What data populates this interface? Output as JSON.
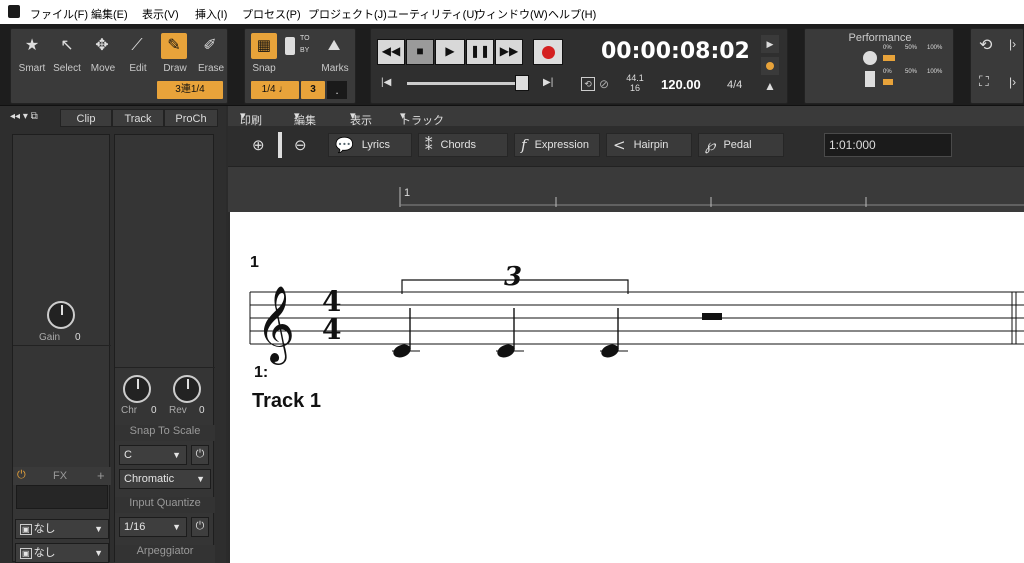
{
  "menubar": {
    "items": [
      "ファイル(F)",
      "編集(E)",
      "表示(V)",
      "挿入(I)",
      "プロセス(P)",
      "プロジェクト(J)",
      "ユーティリティ(U)",
      "ウィンドウ(W)",
      "ヘルプ(H)"
    ]
  },
  "tools": {
    "items": [
      "Smart",
      "Select",
      "Move",
      "Edit",
      "Draw",
      "Erase"
    ],
    "active": "Draw",
    "triplet_value": "3連1/4"
  },
  "snap": {
    "label": "Snap",
    "marks_label": "Marks",
    "value": "1/4",
    "note_glyph": "♩",
    "tuplet": "3",
    "dot": ".",
    "to_by": [
      "TO",
      "BY"
    ]
  },
  "transport": {
    "time": "00:00:08:02",
    "sample_rate": "44.1",
    "bit_depth": "16",
    "tempo": "120.00",
    "meter": "4/4",
    "accent_color": "#e8a33a",
    "record_color": "#d42020"
  },
  "performance": {
    "title": "Performance",
    "meter_labels": [
      "0%",
      "50%",
      "100%"
    ]
  },
  "leftpanel": {
    "tabs": [
      "Clip",
      "Track",
      "ProCh"
    ],
    "gain_label": "Gain",
    "gain_value": "0",
    "chr_label": "Chr",
    "chr_value": "0",
    "rev_label": "Rev",
    "rev_value": "0",
    "fx_label": "FX",
    "fx_add": "+",
    "io_a": "なし",
    "io_b": "なし",
    "snap_to_scale": "Snap To Scale",
    "scale_root": "C",
    "scale_type": "Chromatic",
    "input_quantize": "Input Quantize",
    "quantize_value": "1/16",
    "arpeggiator": "Arpeggiator"
  },
  "editor": {
    "menu": [
      "印刷",
      "編集",
      "表示",
      "トラック"
    ],
    "buttons": [
      {
        "icon": "lyrics-icon",
        "label": "Lyrics"
      },
      {
        "icon": "chords-icon",
        "label": "Chords"
      },
      {
        "icon": "expression-icon",
        "label": "Expression"
      },
      {
        "icon": "hairpin-icon",
        "label": "Hairpin"
      },
      {
        "icon": "pedal-icon",
        "label": "Pedal"
      }
    ],
    "position": "1:01:000",
    "ruler_marker": "1"
  },
  "score": {
    "measure_number": "1",
    "time_sig_top": "4",
    "time_sig_bottom": "4",
    "tuplet_number": "3",
    "track_index": "1:",
    "track_name": "Track 1"
  }
}
